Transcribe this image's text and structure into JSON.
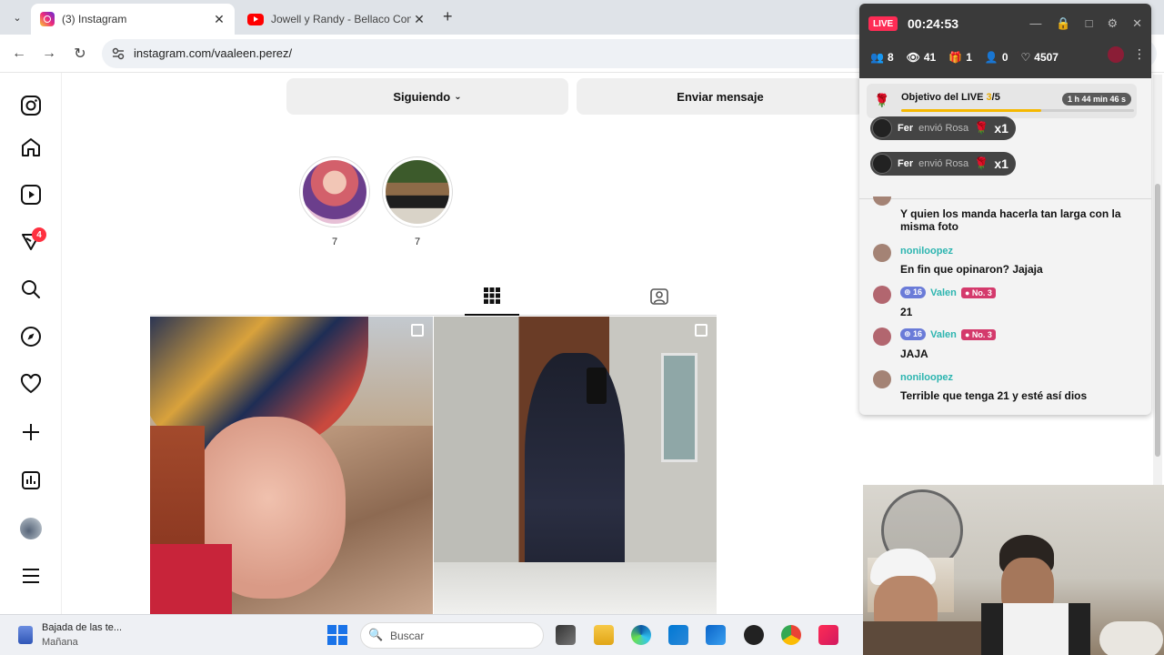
{
  "browser": {
    "tabs": [
      {
        "title": "(3) Instagram",
        "active": true,
        "icon": "instagram-icon"
      },
      {
        "title": "Jowell y Randy - Bellaco Con Be",
        "active": false,
        "icon": "youtube-icon"
      }
    ],
    "url": "instagram.com/vaaleen.perez/"
  },
  "instagram": {
    "sidebar_badge": "4",
    "buttons": {
      "following": "Siguiendo",
      "message": "Enviar mensaje"
    },
    "highlights": [
      {
        "label": "7"
      },
      {
        "label": "7"
      }
    ]
  },
  "live": {
    "badge": "LIVE",
    "timer": "00:24:53",
    "stats": {
      "members": "8",
      "viewers": "41",
      "gifts": "1",
      "follows": "0",
      "likes": "4507"
    },
    "goal": {
      "label": "Objetivo del LIVE ",
      "current": "3",
      "total": "/5",
      "time": "1 h 44 min 46 s",
      "progress": 0.6
    },
    "gift_events": [
      {
        "user": "Fer",
        "verb": "envió Rosa",
        "count": "x1"
      },
      {
        "user": "Fer",
        "verb": "envió Rosa",
        "count": "x1"
      }
    ],
    "chat": [
      {
        "user": "",
        "text": "Y quien los manda hacerla tan larga con la misma foto"
      },
      {
        "user": "noniloopez",
        "text": "En fin que opinaron? Jajaja"
      },
      {
        "user": "Valen",
        "level": "16",
        "rank": "No. 3",
        "text": "21"
      },
      {
        "user": "Valen",
        "level": "16",
        "rank": "No. 3",
        "text": "JAJA"
      },
      {
        "user": "noniloopez",
        "text": "Terrible que tenga 21 y esté así dios"
      }
    ]
  },
  "taskbar": {
    "weather_title": "Bajada de las te...",
    "weather_sub": "Mañana",
    "search_placeholder": "Buscar"
  },
  "colors": {
    "live_red": "#fe2c55",
    "chat_user": "#2db5b0",
    "goal_fill": "#f5b800",
    "ig_badge": "#ff3040"
  }
}
